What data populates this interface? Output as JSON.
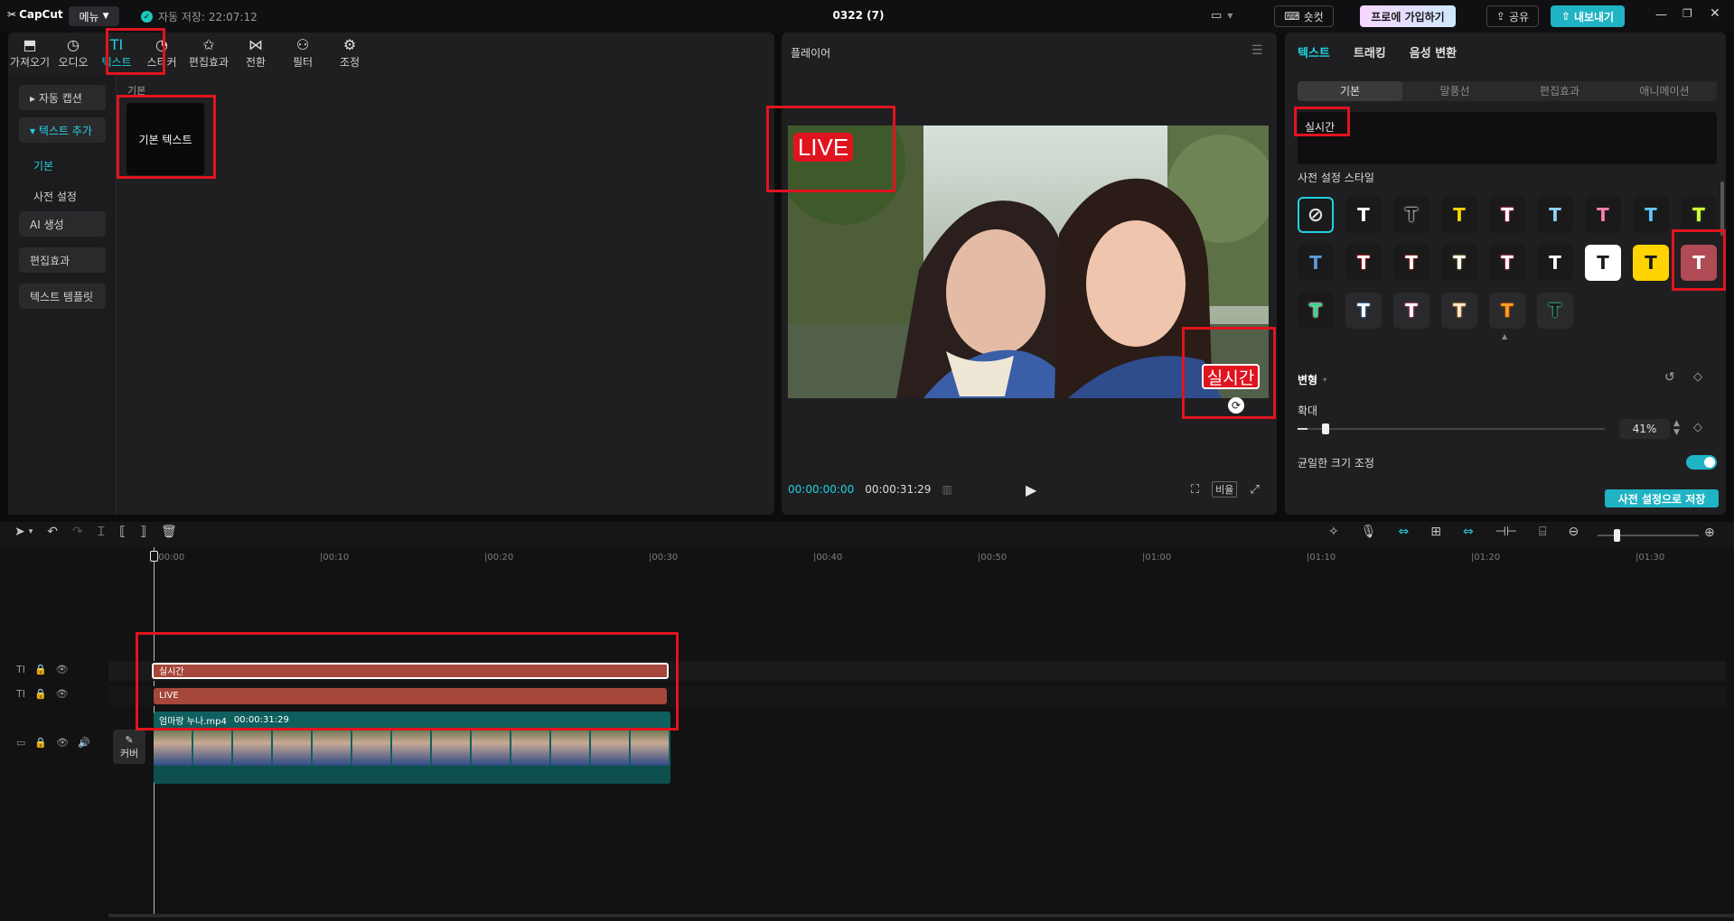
{
  "app": {
    "logo": "CapCut",
    "menu_label": "메뉴",
    "autosave_text": "자동 저장: 22:07:12",
    "project_title": "0322 (7)",
    "shortcut_label": "숏컷",
    "pro_label": "프로에 가입하기",
    "share_label": "공유",
    "export_label": "내보내기",
    "accent": "#1fd1e0",
    "highlight": "#e0141f"
  },
  "toolbar": {
    "items": [
      {
        "label": "가져오기",
        "icon": "import-icon"
      },
      {
        "label": "오디오",
        "icon": "audio-icon"
      },
      {
        "label": "텍스트",
        "icon": "text-icon",
        "active": true
      },
      {
        "label": "스티커",
        "icon": "sticker-icon"
      },
      {
        "label": "편집효과",
        "icon": "effects-icon"
      },
      {
        "label": "전환",
        "icon": "transition-icon"
      },
      {
        "label": "필터",
        "icon": "filter-icon"
      },
      {
        "label": "조정",
        "icon": "adjust-icon"
      }
    ]
  },
  "sidebar": {
    "items": [
      {
        "label": "▸ 자동 캡션"
      },
      {
        "label": "▾ 텍스트 추가"
      }
    ],
    "subitems": [
      {
        "label": "기본",
        "active": true
      },
      {
        "label": "사전 설정"
      }
    ],
    "items2": [
      {
        "label": "AI 생성"
      },
      {
        "label": "편집효과"
      },
      {
        "label": "텍스트 템플릿"
      }
    ]
  },
  "library": {
    "section_label": "기본",
    "card_label": "기본 텍스트"
  },
  "player": {
    "title": "플레이어",
    "live_text": "LIVE",
    "caption_text": "실시간",
    "time_current": "00:00:00:00",
    "time_total": "00:00:31:29",
    "ratio_label": "비율"
  },
  "inspector": {
    "tabs": [
      "텍스트",
      "트래킹",
      "음성 변환"
    ],
    "subtabs": [
      "기본",
      "말풍선",
      "편집효과",
      "애니메이션"
    ],
    "text_value": "실시간",
    "preset_title": "사전 설정 스타일",
    "transform_title": "변형",
    "scale_label": "확대",
    "scale_value": "41%",
    "scale_fraction": 0.41,
    "uniform_label": "균일한 크기 조정",
    "save_preset_label": "사전 설정으로 저장"
  },
  "styles": [
    {
      "fg": "",
      "bg": "#1a1a1a",
      "outline": "#1fd1e0",
      "none": true
    },
    {
      "fg": "#ffffff",
      "bg": "#1a1a1a"
    },
    {
      "fg": "#1a1a1a",
      "bg": "#1a1a1a",
      "stroke": "#ffffff"
    },
    {
      "fg": "#ffd400",
      "bg": "#1a1a1a"
    },
    {
      "fg": "#ffffff",
      "bg": "#1a1a1a",
      "stroke": "#e63b6b"
    },
    {
      "fg": "#8ed3ff",
      "bg": "#1a1a1a"
    },
    {
      "fg": "#ff7fb0",
      "bg": "#1a1a1a"
    },
    {
      "fg": "#5fc8ff",
      "bg": "#1a1a1a"
    },
    {
      "fg": "#d6ff3a",
      "bg": "#1a1a1a",
      "stroke": "#3a6b2a"
    },
    {
      "fg": "#5a9bd8",
      "bg": "#1a1a1a"
    },
    {
      "fg": "#ffffff",
      "bg": "#1a1a1a",
      "stroke": "#e0141f"
    },
    {
      "fg": "#ffffff",
      "bg": "#1a1a1a",
      "stroke": "#b03030"
    },
    {
      "fg": "#ffffff",
      "bg": "#1a1a1a",
      "stroke": "#9c8a3a"
    },
    {
      "fg": "#ffffff",
      "bg": "#1a1a1a",
      "stroke": "#e04060"
    },
    {
      "fg": "#ffffff",
      "bg": "#1a1a1a"
    },
    {
      "fg": "#1a1a1a",
      "bg": "#ffffff"
    },
    {
      "fg": "#1a1a1a",
      "bg": "#ffd400"
    },
    {
      "fg": "#ffffff",
      "bg": "#b04a55",
      "selected": true
    },
    {
      "fg": "#3ad68c",
      "bg": "#1a1a1a",
      "stroke": "#ffffff"
    },
    {
      "fg": "#ffffff",
      "bg": "#2a2a2d",
      "stroke": "#4a8ad8"
    },
    {
      "fg": "#ffffff",
      "bg": "#2a2a2d",
      "stroke": "#d85090"
    },
    {
      "fg": "#ffe9c8",
      "bg": "#2a2a2d",
      "stroke": "#c98a4a"
    },
    {
      "fg": "#ffa020",
      "bg": "#2a2a2d",
      "stroke": "#c04a10"
    },
    {
      "fg": "#1a1a1a",
      "bg": "#2a2a2d",
      "stroke": "#3ad68c"
    }
  ],
  "timeline": {
    "ruler": [
      "00:00",
      "00:10",
      "00:20",
      "00:30",
      "00:40",
      "00:50",
      "01:00",
      "01:10",
      "01:20",
      "01:30"
    ],
    "text_clip_1": "실시간",
    "text_clip_2": "LIVE",
    "video_clip_name": "엄마랑 누나.mp4",
    "video_clip_duration": "00:00:31:29",
    "cover_label": "커버"
  }
}
